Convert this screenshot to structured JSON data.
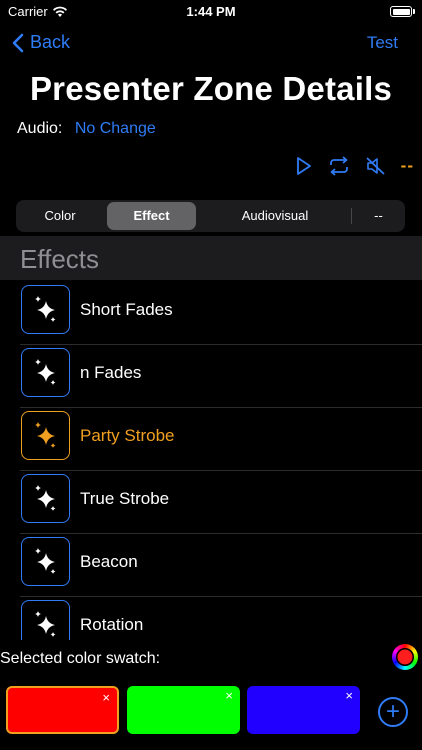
{
  "status_bar": {
    "carrier": "Carrier",
    "time": "1:44 PM"
  },
  "nav": {
    "back_label": "Back",
    "action_label": "Test"
  },
  "title": "Presenter Zone Details",
  "audio": {
    "label": "Audio:",
    "value": "No Change"
  },
  "controls": {
    "extra": "--",
    "accent_color": "#f0a020"
  },
  "segments": [
    "Color",
    "Effect",
    "Audiovisual",
    "--"
  ],
  "selected_segment": "Effect",
  "section_title": "Effects",
  "effects": [
    {
      "name": "Short Fades"
    },
    {
      "name": "n Fades"
    },
    {
      "name": "Party Strobe"
    },
    {
      "name": "True Strobe"
    },
    {
      "name": "Beacon"
    },
    {
      "name": "Rotation"
    }
  ],
  "selected_effect": "Party Strobe",
  "swatch_section": {
    "label": "Selected color swatch:",
    "swatches": [
      {
        "color": "#ff0000",
        "selected": true
      },
      {
        "color": "#00ff00",
        "selected": false
      },
      {
        "color": "#2200ff",
        "selected": false
      }
    ],
    "remove_glyph": "×",
    "add_glyph": "+"
  },
  "colors": {
    "accent": "#2f7cf6",
    "highlight": "#f0a020"
  }
}
